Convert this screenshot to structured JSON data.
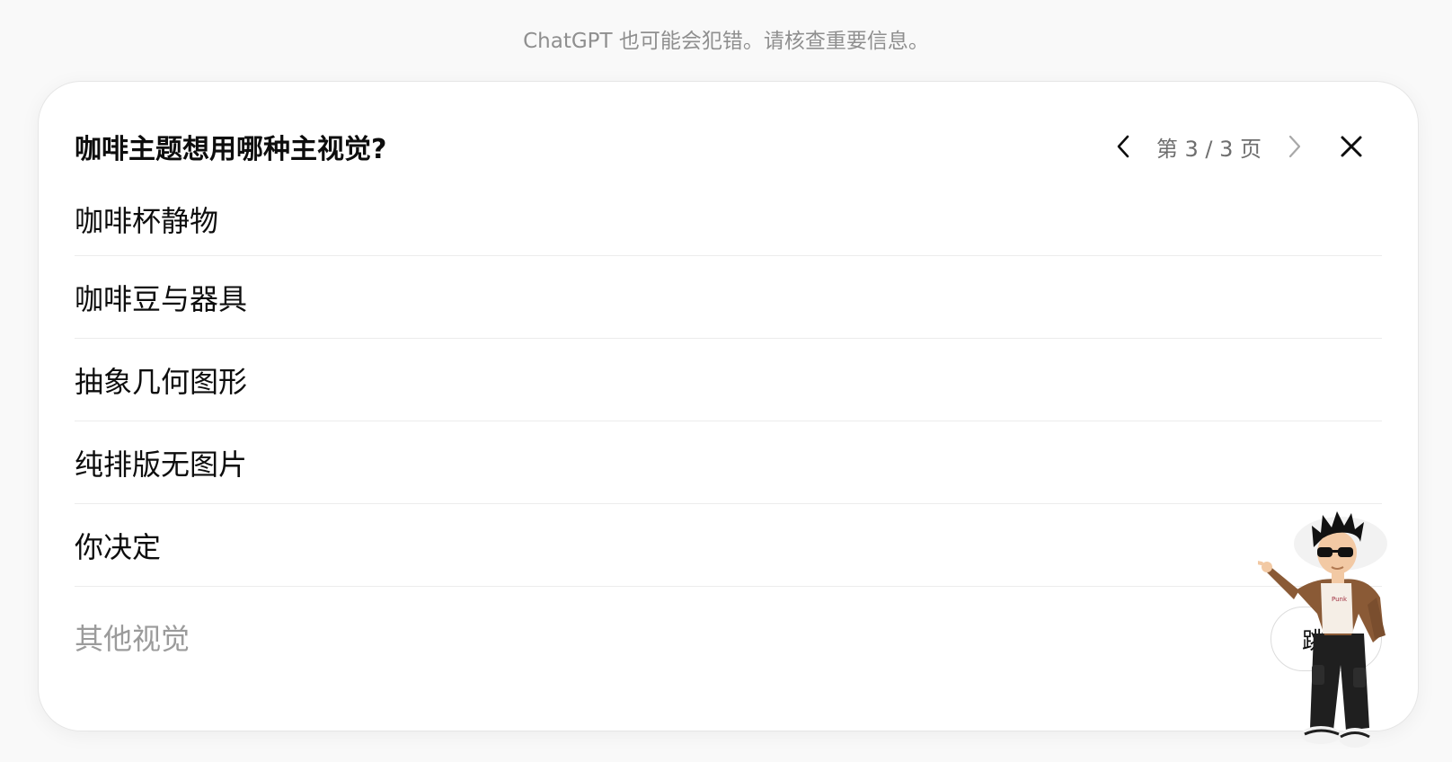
{
  "disclaimer": "ChatGPT 也可能会犯错。请核查重要信息。",
  "card": {
    "title": "咖啡主题想用哪种主视觉?",
    "pager": {
      "text": "第 3 / 3 页",
      "current": 3,
      "total": 3
    },
    "options": [
      {
        "label": "咖啡杯静物"
      },
      {
        "label": "咖啡豆与器具"
      },
      {
        "label": "抽象几何图形"
      },
      {
        "label": "纯排版无图片"
      },
      {
        "label": "你决定"
      }
    ],
    "other": {
      "placeholder": "其他视觉",
      "value": ""
    },
    "skip_label": "跳过"
  },
  "mascot": {
    "shirt_text": "Punk"
  },
  "icons": {
    "prev": "chevron-left-icon",
    "next": "chevron-right-icon",
    "close": "close-icon"
  },
  "colors": {
    "background": "#f9f9f9",
    "card": "#ffffff",
    "text": "#0d0d0d",
    "muted": "#8f8f8f",
    "divider": "#ececec"
  }
}
